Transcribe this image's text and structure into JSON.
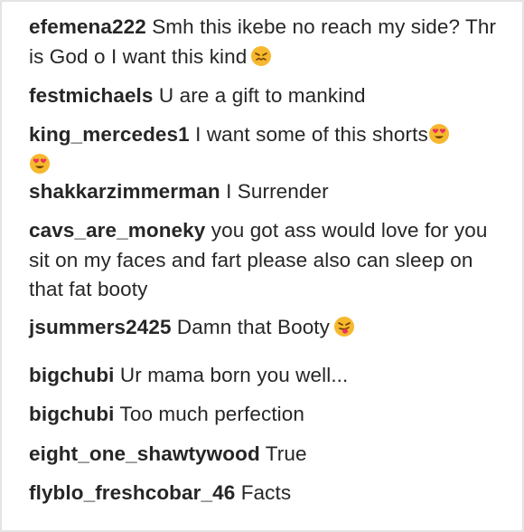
{
  "comments": [
    {
      "user": "efemena222",
      "text": "Smh this ikebe no reach my side? Thr is God o I want this kind",
      "emoji": "confounded-face-emoji"
    },
    {
      "user": "festmichaels",
      "text": "U are a gift to mankind"
    },
    {
      "user": "king_mercedes1",
      "text": "I want some of this shorts",
      "emoji": "heart-eyes-emoji",
      "emoji2": "heart-eyes-emoji"
    },
    {
      "user": "shakkarzimmerman",
      "text": "I Surrender"
    },
    {
      "user": "cavs_are_moneky",
      "text": "you got ass would love for you sit on my faces and fart please also can sleep on that fat booty"
    },
    {
      "user": "jsummers2425",
      "text": "Damn that Booty",
      "emoji": "tongue-face-emoji"
    },
    {
      "user": "bigchubi",
      "text": "Ur mama born you well..."
    },
    {
      "user": "bigchubi",
      "text": "Too much perfection"
    },
    {
      "user": "eight_one_shawtywood",
      "text": "True"
    },
    {
      "user": "flyblo_freshcobar_46",
      "text": "Facts"
    }
  ],
  "colors": {
    "username": "#262626",
    "text": "#262626",
    "emoji_face": "#f5b82e",
    "heart": "#e8335a"
  }
}
